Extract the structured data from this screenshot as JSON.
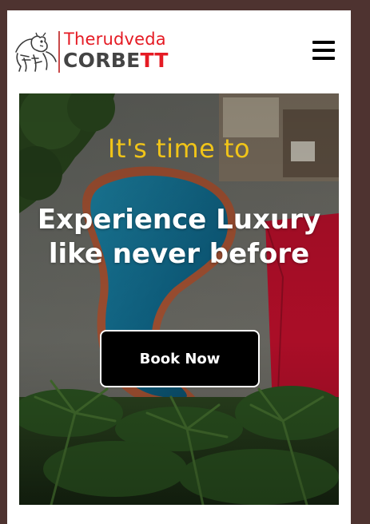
{
  "header": {
    "logo": {
      "line1": "Therudveda",
      "line2_main": "CORBE",
      "line2_accent": "TT",
      "tiger_icon": "tiger-emblem"
    },
    "menu_icon": "hamburger-menu"
  },
  "hero": {
    "kicker": "It's time to",
    "title": "Experience Luxury like never before",
    "cta_label": "Book Now"
  },
  "colors": {
    "page_bg": "#4e3330",
    "kicker": "#f0c419",
    "brand_red": "#e51b24",
    "brand_gray": "#444444",
    "button_bg": "#000000"
  }
}
